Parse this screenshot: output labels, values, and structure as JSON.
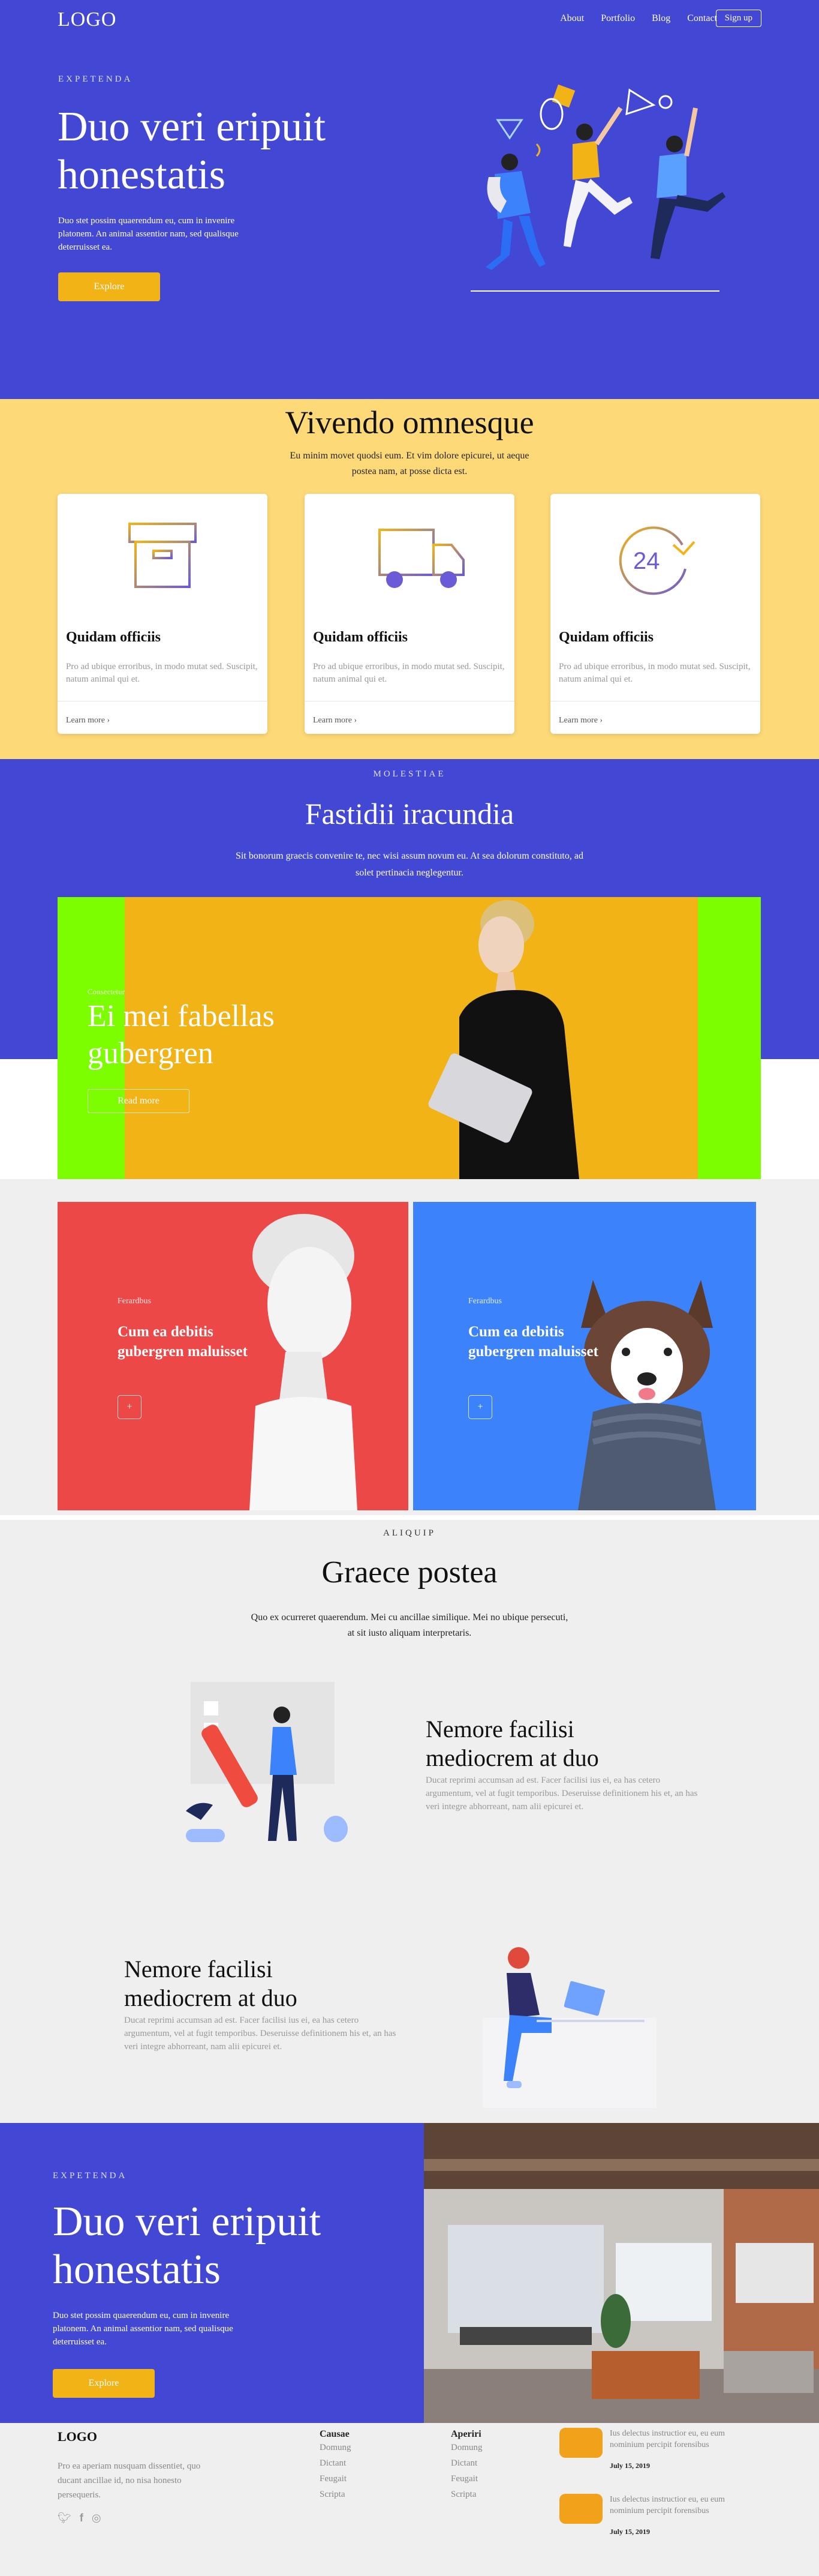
{
  "colors": {
    "primary": "#4348d4",
    "accent": "#f2b316",
    "yellow_band": "#fed977",
    "light_bg": "#efefef",
    "green": "#7dfe00",
    "red": "#ec4847",
    "blue": "#3c82fa"
  },
  "header": {
    "logo": "LOGO",
    "nav": [
      "About",
      "Portfolio",
      "Blog",
      "Contact"
    ],
    "signup": "Sign up"
  },
  "hero": {
    "kicker": "EXPETENDA",
    "title_line1": "Duo veri eripuit",
    "title_line2": "honestatis",
    "text": "Duo stet possim quaerendum eu, cum in invenire platonem. An animal assentior nam, sed qualisque deterruisset ea.",
    "button": "Explore"
  },
  "services": {
    "title": "Vivendo omnesque",
    "subtitle": "Eu minim movet quodsi eum. Et vim dolore epicurei, ut aeque postea nam, at posse dicta est.",
    "cards": [
      {
        "icon": "box-icon",
        "title": "Quidam officiis",
        "text": "Pro ad ubique erroribus, in modo mutat sed. Suscipit, natum animal qui et.",
        "link": "Learn more"
      },
      {
        "icon": "truck-icon",
        "title": "Quidam officiis",
        "text": "Pro ad ubique erroribus, in modo mutat sed. Suscipit, natum animal qui et.",
        "link": "Learn more"
      },
      {
        "icon": "clock-24-icon",
        "title": "Quidam officiis",
        "text": "Pro ad ubique erroribus, in modo mutat sed. Suscipit, natum animal qui et.",
        "link": "Learn more"
      }
    ],
    "clock_label": "24"
  },
  "showcase": {
    "kicker": "MOLESTIAE",
    "title": "Fastidii iracundia",
    "subtitle": "Sit bonorum graecis convenire te, nec wisi assum novum eu. At sea dolorum constituto, ad solet pertinacia neglegentur.",
    "banner_small": "Consectetur",
    "banner_title_line1": "Ei mei fabellas",
    "banner_title_line2": "gubergren",
    "banner_button": "Read more"
  },
  "promo": [
    {
      "small": "Ferardbus",
      "title": "Cum ea debitis gubergren maluisset",
      "button": "+"
    },
    {
      "small": "Ferardbus",
      "title": "Cum ea debitis gubergren maluisset",
      "button": "+"
    }
  ],
  "features": {
    "kicker": "ALIQUIP",
    "title": "Graece postea",
    "subtitle": "Quo ex ocurreret quaerendum. Mei cu ancillae similique. Mei no ubique persecuti, at sit iusto aliquam interpretaris.",
    "items": [
      {
        "title": "Nemore facilisi mediocrem at duo",
        "text": "Ducat reprimi accumsan ad est. Facer facilisi ius ei, ea has cetero argumentum, vel at fugit temporibus. Deseruisse definitionem his et, an has veri integre abhorreant, nam alii epicurei et."
      },
      {
        "title": "Nemore facilisi mediocrem at duo",
        "text": "Ducat reprimi accumsan ad est. Facer facilisi ius ei, ea has cetero argumentum, vel at fugit temporibus. Deseruisse definitionem his et, an has veri integre abhorreant, nam alii epicurei et."
      }
    ]
  },
  "cta": {
    "kicker": "EXPETENDA",
    "title_line1": "Duo veri eripuit",
    "title_line2": "honestatis",
    "text": "Duo stet possim quaerendum eu, cum in invenire platonem. An animal assentior nam, sed qualisque deterruisset ea.",
    "button": "Explore"
  },
  "footer": {
    "logo": "LOGO",
    "about": "Pro ea aperiam nusquam dissentiet, quo ducant ancillae id, no nisa honesto persequeris.",
    "col1": {
      "title": "Causae",
      "links": [
        "Domung",
        "Dictant",
        "Feugait",
        "Scripta"
      ]
    },
    "col2": {
      "title": "Aperiri",
      "links": [
        "Domung",
        "Dictant",
        "Feugait",
        "Scripta"
      ]
    },
    "posts": [
      {
        "text": "Ius delectus instructior eu, eu eum nominium percipit forensibus",
        "date": "July 15, 2019"
      },
      {
        "text": "Ius delectus instructior eu, eu eum nominium percipit forensibus",
        "date": "July 15, 2019"
      }
    ],
    "social": [
      "twitter-icon",
      "facebook-icon",
      "instagram-icon"
    ]
  }
}
